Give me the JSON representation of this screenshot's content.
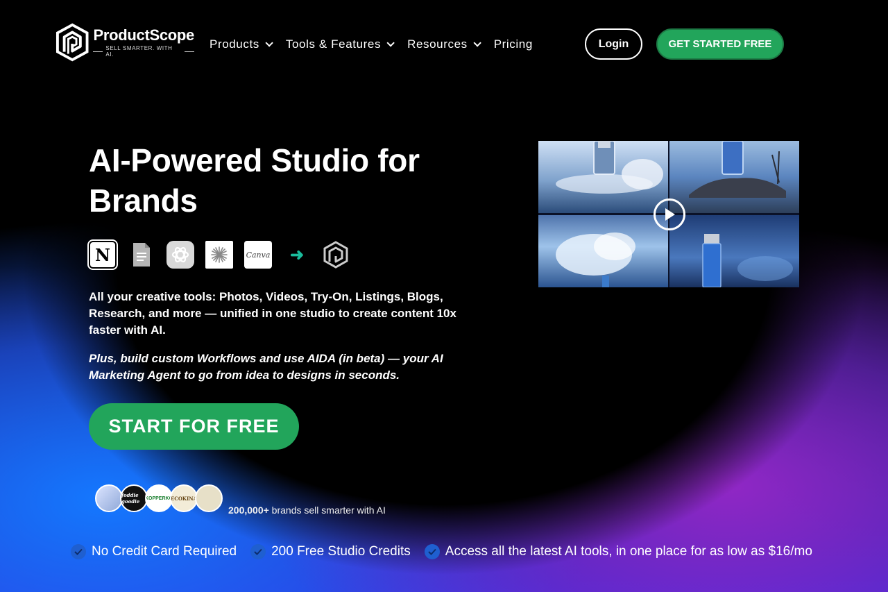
{
  "brand": {
    "name": "ProductScope",
    "tagline": "SELL SMARTER. WITH AI."
  },
  "nav": {
    "items": [
      {
        "label": "Products",
        "has_dropdown": true
      },
      {
        "label": "Tools & Features",
        "has_dropdown": true
      },
      {
        "label": "Resources",
        "has_dropdown": true
      },
      {
        "label": "Pricing",
        "has_dropdown": false
      }
    ],
    "login_label": "Login",
    "cta_label": "GET STARTED FREE"
  },
  "hero": {
    "title": "AI-Powered Studio for Brands",
    "tools": [
      "notion-icon",
      "google-docs-icon",
      "chatgpt-icon",
      "claude-icon",
      "canva-icon",
      "arrow-right-icon",
      "productscope-icon"
    ],
    "canva_text": "Canva",
    "notion_text": "N",
    "arrow_text": "➜",
    "description": "All your creative tools: Photos, Videos, Try-On, Listings, Blogs, Research, and more — unified in one studio to create content 10x faster with AI.",
    "subdescription": "Plus, build custom Workflows and use AIDA (in beta) — your AI Marketing Agent to go from idea to designs in seconds.",
    "start_button": "START FOR FREE"
  },
  "social_proof": {
    "count": "200,000+",
    "text": " brands sell smarter with AI",
    "avatars": [
      "",
      "foddie goodie",
      "KOPPERKG",
      "ECOKINA",
      "logo"
    ]
  },
  "features": [
    {
      "label": "No Credit Card Required"
    },
    {
      "label": "200 Free Studio Credits"
    },
    {
      "label": "Access all the latest AI tools, in one place for as low as $16/mo"
    }
  ],
  "colors": {
    "accent_green": "#22a55b",
    "check_blue": "#1f5fd0",
    "arrow_teal": "#1abc9c"
  }
}
